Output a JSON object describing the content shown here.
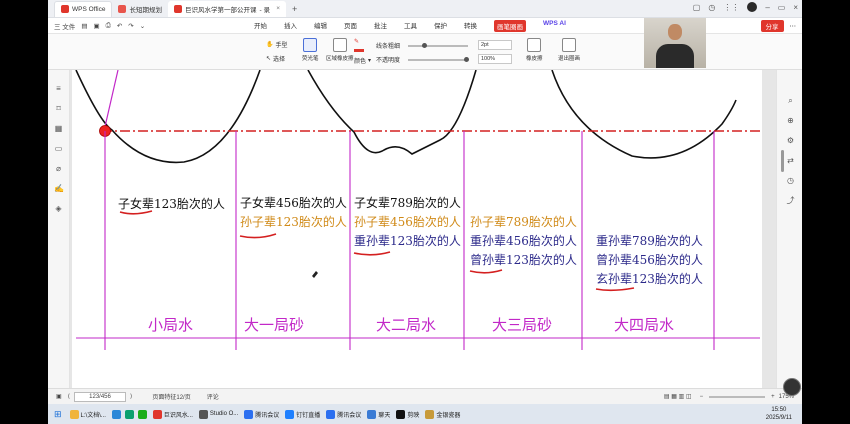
{
  "titlebar": {
    "wps_tab": "WPS Office",
    "tab2": "长短期规划",
    "active_tab": "巨识风水学第一部公开课",
    "active_tab_suffix": "- 录"
  },
  "menubar": {
    "file": "三 文件",
    "items": [
      "开始",
      "插入",
      "编辑",
      "页面",
      "批注",
      "工具",
      "保护",
      "转换",
      "画笔圈画"
    ],
    "ai": "WPS AI",
    "share": "分享"
  },
  "ribbon": {
    "hand": "手型",
    "select": "选择",
    "pen": "荧光笔",
    "eraser_area": "区域橡皮擦",
    "color": "颜色",
    "line_width": "线条粗细",
    "opacity": "不透明度",
    "width_value": "2pt",
    "opacity_value": "100%",
    "eraser": "橡皮擦",
    "exit": "退出圈画"
  },
  "document": {
    "segments": [
      {
        "label": "小局水",
        "lines": [
          {
            "text": "子女辈123胎次的人",
            "color": "black"
          }
        ]
      },
      {
        "label": "大一局砂",
        "lines": [
          {
            "text": "子女辈456胎次的人",
            "color": "black"
          },
          {
            "text": "孙子辈123胎次的人",
            "color": "orange"
          }
        ]
      },
      {
        "label": "大二局水",
        "lines": [
          {
            "text": "子女辈789胎次的人",
            "color": "black"
          },
          {
            "text": "孙子辈456胎次的人",
            "color": "orange"
          },
          {
            "text": "重孙辈123胎次的人",
            "color": "blue"
          }
        ]
      },
      {
        "label": "大三局砂",
        "lines": [
          {
            "text": "孙子辈789胎次的人",
            "color": "orange"
          },
          {
            "text": "重孙辈456胎次的人",
            "color": "blue"
          },
          {
            "text": "曾孙辈123胎次的人",
            "color": "blue"
          }
        ]
      },
      {
        "label": "大四局水",
        "lines": [
          {
            "text": "重孙辈789胎次的人",
            "color": "blue"
          },
          {
            "text": "曾孙辈456胎次的人",
            "color": "blue"
          },
          {
            "text": "玄孙辈123胎次的人",
            "color": "blue"
          }
        ]
      }
    ]
  },
  "statusbar": {
    "page": "123/456",
    "info": "页面特征12/页",
    "comment": "评论",
    "zoom": "175%"
  },
  "taskbar": {
    "item1": "L:\\文档\\...",
    "item2": "巨识风水...",
    "item3": "Studio O...",
    "item4": "腾讯会议",
    "item5": "钉钉直播",
    "item6": "腾讯会议",
    "item7": "聊天",
    "item8": "剪映",
    "item9": "金银瓷器",
    "time": "15:50",
    "date": "2025/9/11"
  },
  "colors": {
    "accent": "#e0362c",
    "magenta": "#c228c8",
    "black_text": "#111111",
    "orange_text": "#d08a18",
    "blue_text": "#2c2a8a",
    "dashdot_line": "#d42020"
  }
}
